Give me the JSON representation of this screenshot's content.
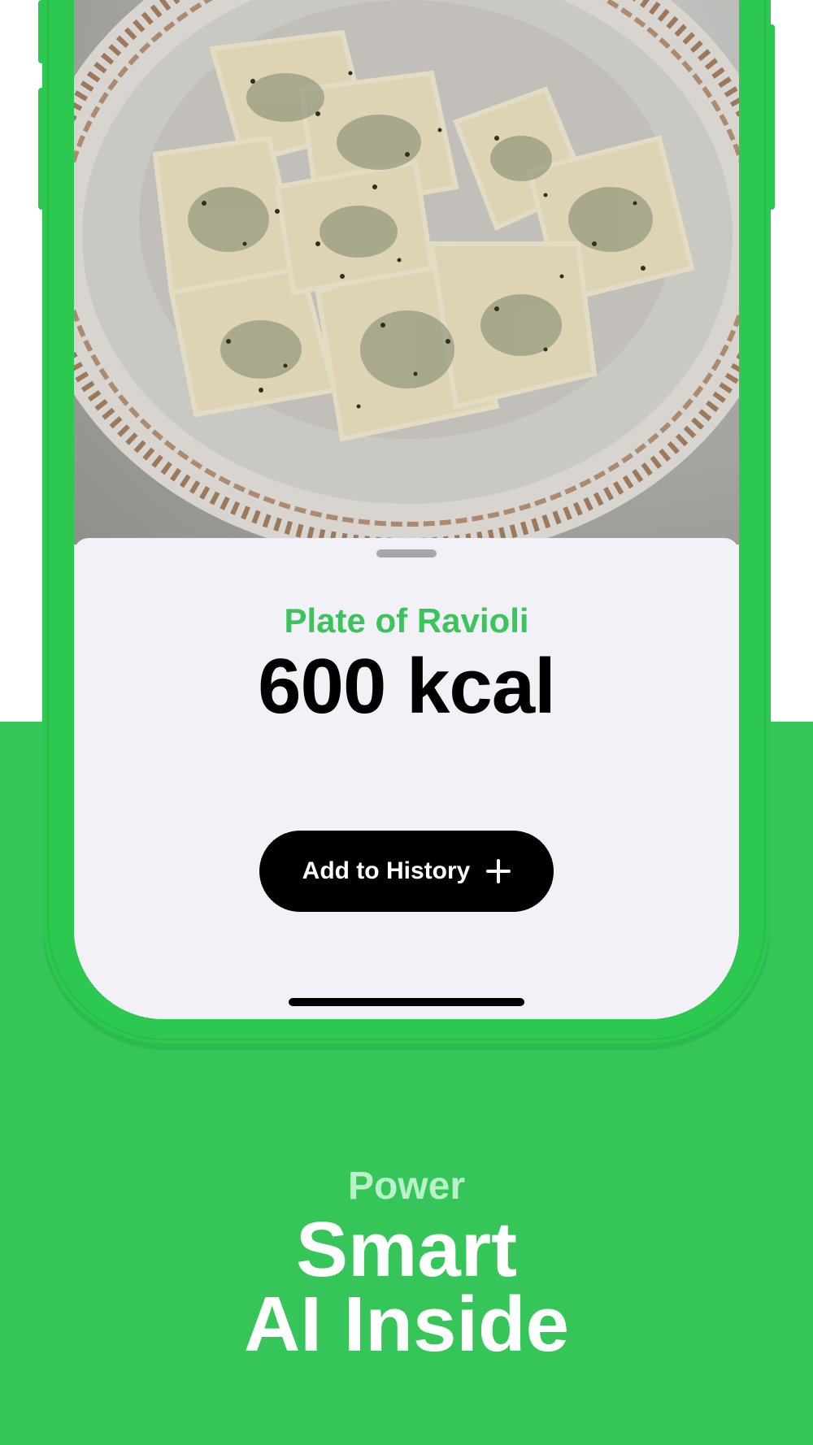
{
  "food": {
    "name": "Plate of Ravioli",
    "calories": "600 kcal"
  },
  "actions": {
    "add_label": "Add to History",
    "add_icon": "plus-icon"
  },
  "promo": {
    "eyebrow": "Power",
    "headline_line1": "Smart",
    "headline_line2": "AI Inside"
  },
  "colors": {
    "brand_green": "#36c558",
    "phone_green": "#2cc84f",
    "food_name_green": "#3ac45b",
    "eyebrow_green": "#b9f2c8",
    "sheet_background": "#f2f1f7",
    "button_black": "#000000"
  }
}
